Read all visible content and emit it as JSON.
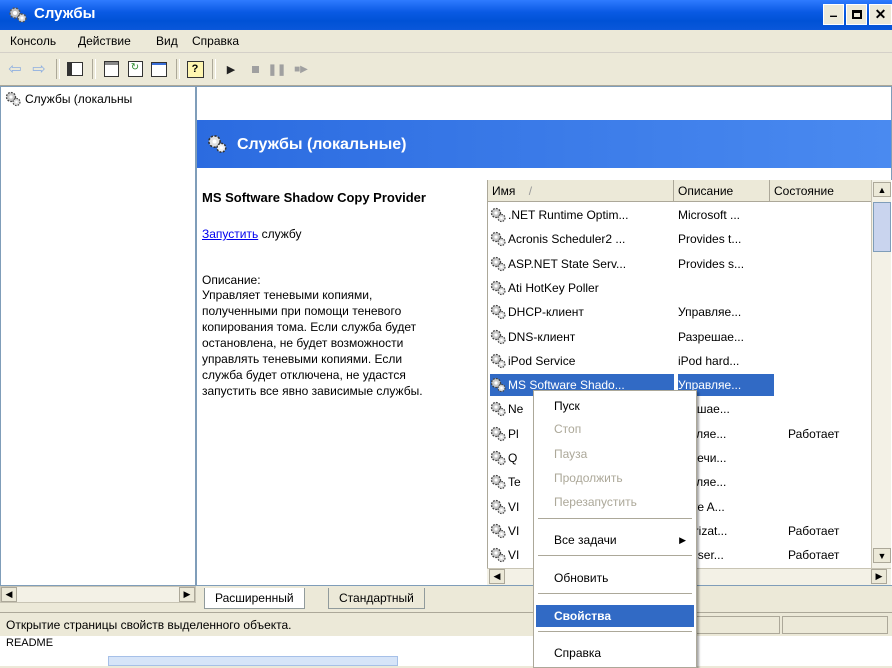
{
  "window": {
    "title": "Службы"
  },
  "menu": [
    "Консоль",
    "Действие",
    "Вид",
    "Справка"
  ],
  "tree": {
    "root_label": "Службы (локальны"
  },
  "banner": {
    "title": "Службы (локальные)"
  },
  "detail": {
    "service_name": "MS Software Shadow Copy Provider",
    "start_link": "Запустить",
    "start_suffix": " службу",
    "desc_label": "Описание:",
    "desc_lines": [
      "Управляет теневыми копиями,",
      "полученными при помощи теневого",
      "копирования тома. Если служба будет",
      "остановлена, не будет возможности",
      "управлять теневыми копиями. Если",
      "служба будет отключена, не удастся",
      "запустить все явно зависимые службы."
    ]
  },
  "list": {
    "headers": [
      "Имя",
      "Описание",
      "Состояние"
    ],
    "sort_arrow": "/",
    "rows": [
      {
        "name": ".NET Runtime Optim...",
        "desc": "Microsoft ...",
        "state": ""
      },
      {
        "name": "Acronis Scheduler2 ...",
        "desc": "Provides t...",
        "state": ""
      },
      {
        "name": "ASP.NET State Serv...",
        "desc": "Provides s...",
        "state": ""
      },
      {
        "name": "Ati HotKey Poller",
        "desc": "",
        "state": ""
      },
      {
        "name": "DHCP-клиент",
        "desc": "Управляе...",
        "state": ""
      },
      {
        "name": "DNS-клиент",
        "desc": "Разрешае...",
        "state": ""
      },
      {
        "name": "iPod Service",
        "desc": "iPod hard...",
        "state": ""
      },
      {
        "name": "MS Software Shado...",
        "desc": "Управляе...",
        "state": "",
        "selected": true
      },
      {
        "name": "Ne",
        "desc": "зрешае...",
        "state": ""
      },
      {
        "name": "Pl",
        "desc": "зволяе...",
        "state": "Работает"
      },
      {
        "name": "Q",
        "desc": "еспечи...",
        "state": ""
      },
      {
        "name": "Te",
        "desc": "зволяе...",
        "state": ""
      },
      {
        "name": "VI",
        "desc": "ware A...",
        "state": ""
      },
      {
        "name": "VI",
        "desc": "thorizat...",
        "state": "Работает"
      },
      {
        "name": "VI",
        "desc": "CP ser...",
        "state": "Работает"
      }
    ]
  },
  "tabs": [
    "Расширенный",
    "Стандартный"
  ],
  "status": {
    "text": "Открытие страницы свойств выделенного объекта."
  },
  "below": {
    "readme": "README"
  },
  "context_menu": {
    "items": [
      {
        "label": "Пуск",
        "state": "enabled"
      },
      {
        "label": "Стоп",
        "state": "disabled"
      },
      {
        "label": "Пауза",
        "state": "disabled"
      },
      {
        "label": "Продолжить",
        "state": "disabled"
      },
      {
        "label": "Перезапустить",
        "state": "disabled"
      },
      {
        "label": "Все задачи",
        "state": "submenu"
      },
      {
        "label": "Обновить",
        "state": "enabled"
      },
      {
        "label": "Свойства",
        "state": "highlighted"
      },
      {
        "label": "Справка",
        "state": "enabled"
      }
    ]
  },
  "colors": {
    "title_blue": "#0A5AE4",
    "selection": "#316AC5",
    "face": "#ECE9D8"
  }
}
